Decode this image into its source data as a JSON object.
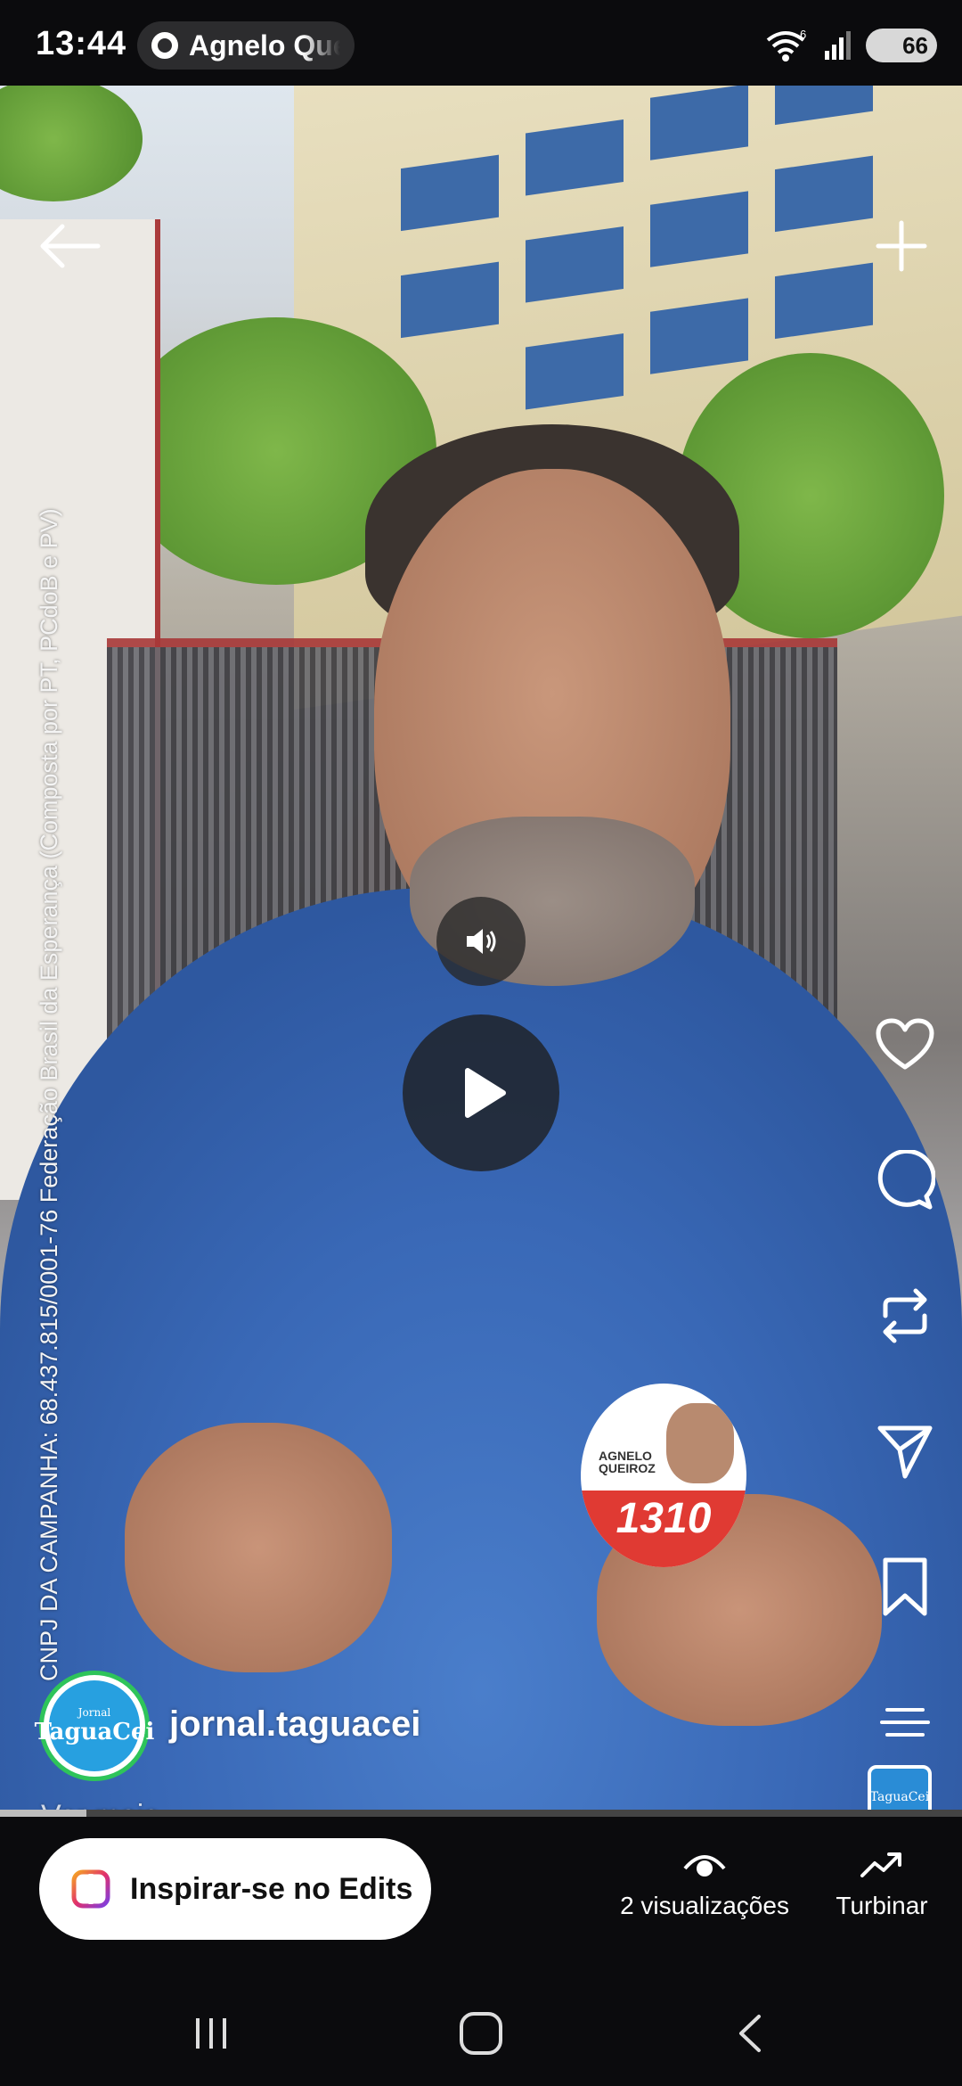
{
  "status_bar": {
    "time": "13:44",
    "notification_app": "Agnelo Queiroz",
    "wifi_label": "6",
    "battery": "66"
  },
  "video": {
    "vertical_caption": "CNPJ DA CAMPANHA: 68.437.815/0001-76 Federação Brasil da Esperança (Composta por PT, PCdoB e PV)",
    "badge_name_line1": "AGNELO",
    "badge_name_line2": "QUEIROZ",
    "badge_number": "1310",
    "progress_fraction": 0.09
  },
  "post": {
    "avatar_small": "Jornal",
    "avatar_brand": "TaguaCei",
    "username": "jornal.taguacei",
    "more_label": "Ver mais",
    "thumb_label": "TaguaCei"
  },
  "bottom": {
    "edits_label": "Inspirar-se no Edits",
    "views_label": "2 visualizações",
    "boost_label": "Turbinar"
  },
  "colors": {
    "status_bg": "#0b0b0d",
    "avatar_ring": "#2ec45a",
    "avatar_fill": "#27a0e0",
    "badge_red": "#e03a33"
  },
  "icons": [
    "back-arrow-icon",
    "plus-icon",
    "sound-icon",
    "play-icon",
    "heart-icon",
    "comment-icon",
    "repost-icon",
    "share-icon",
    "bookmark-icon",
    "more-icon",
    "edits-icon",
    "eye-icon",
    "trending-icon",
    "recents-icon",
    "home-icon",
    "back-icon"
  ]
}
